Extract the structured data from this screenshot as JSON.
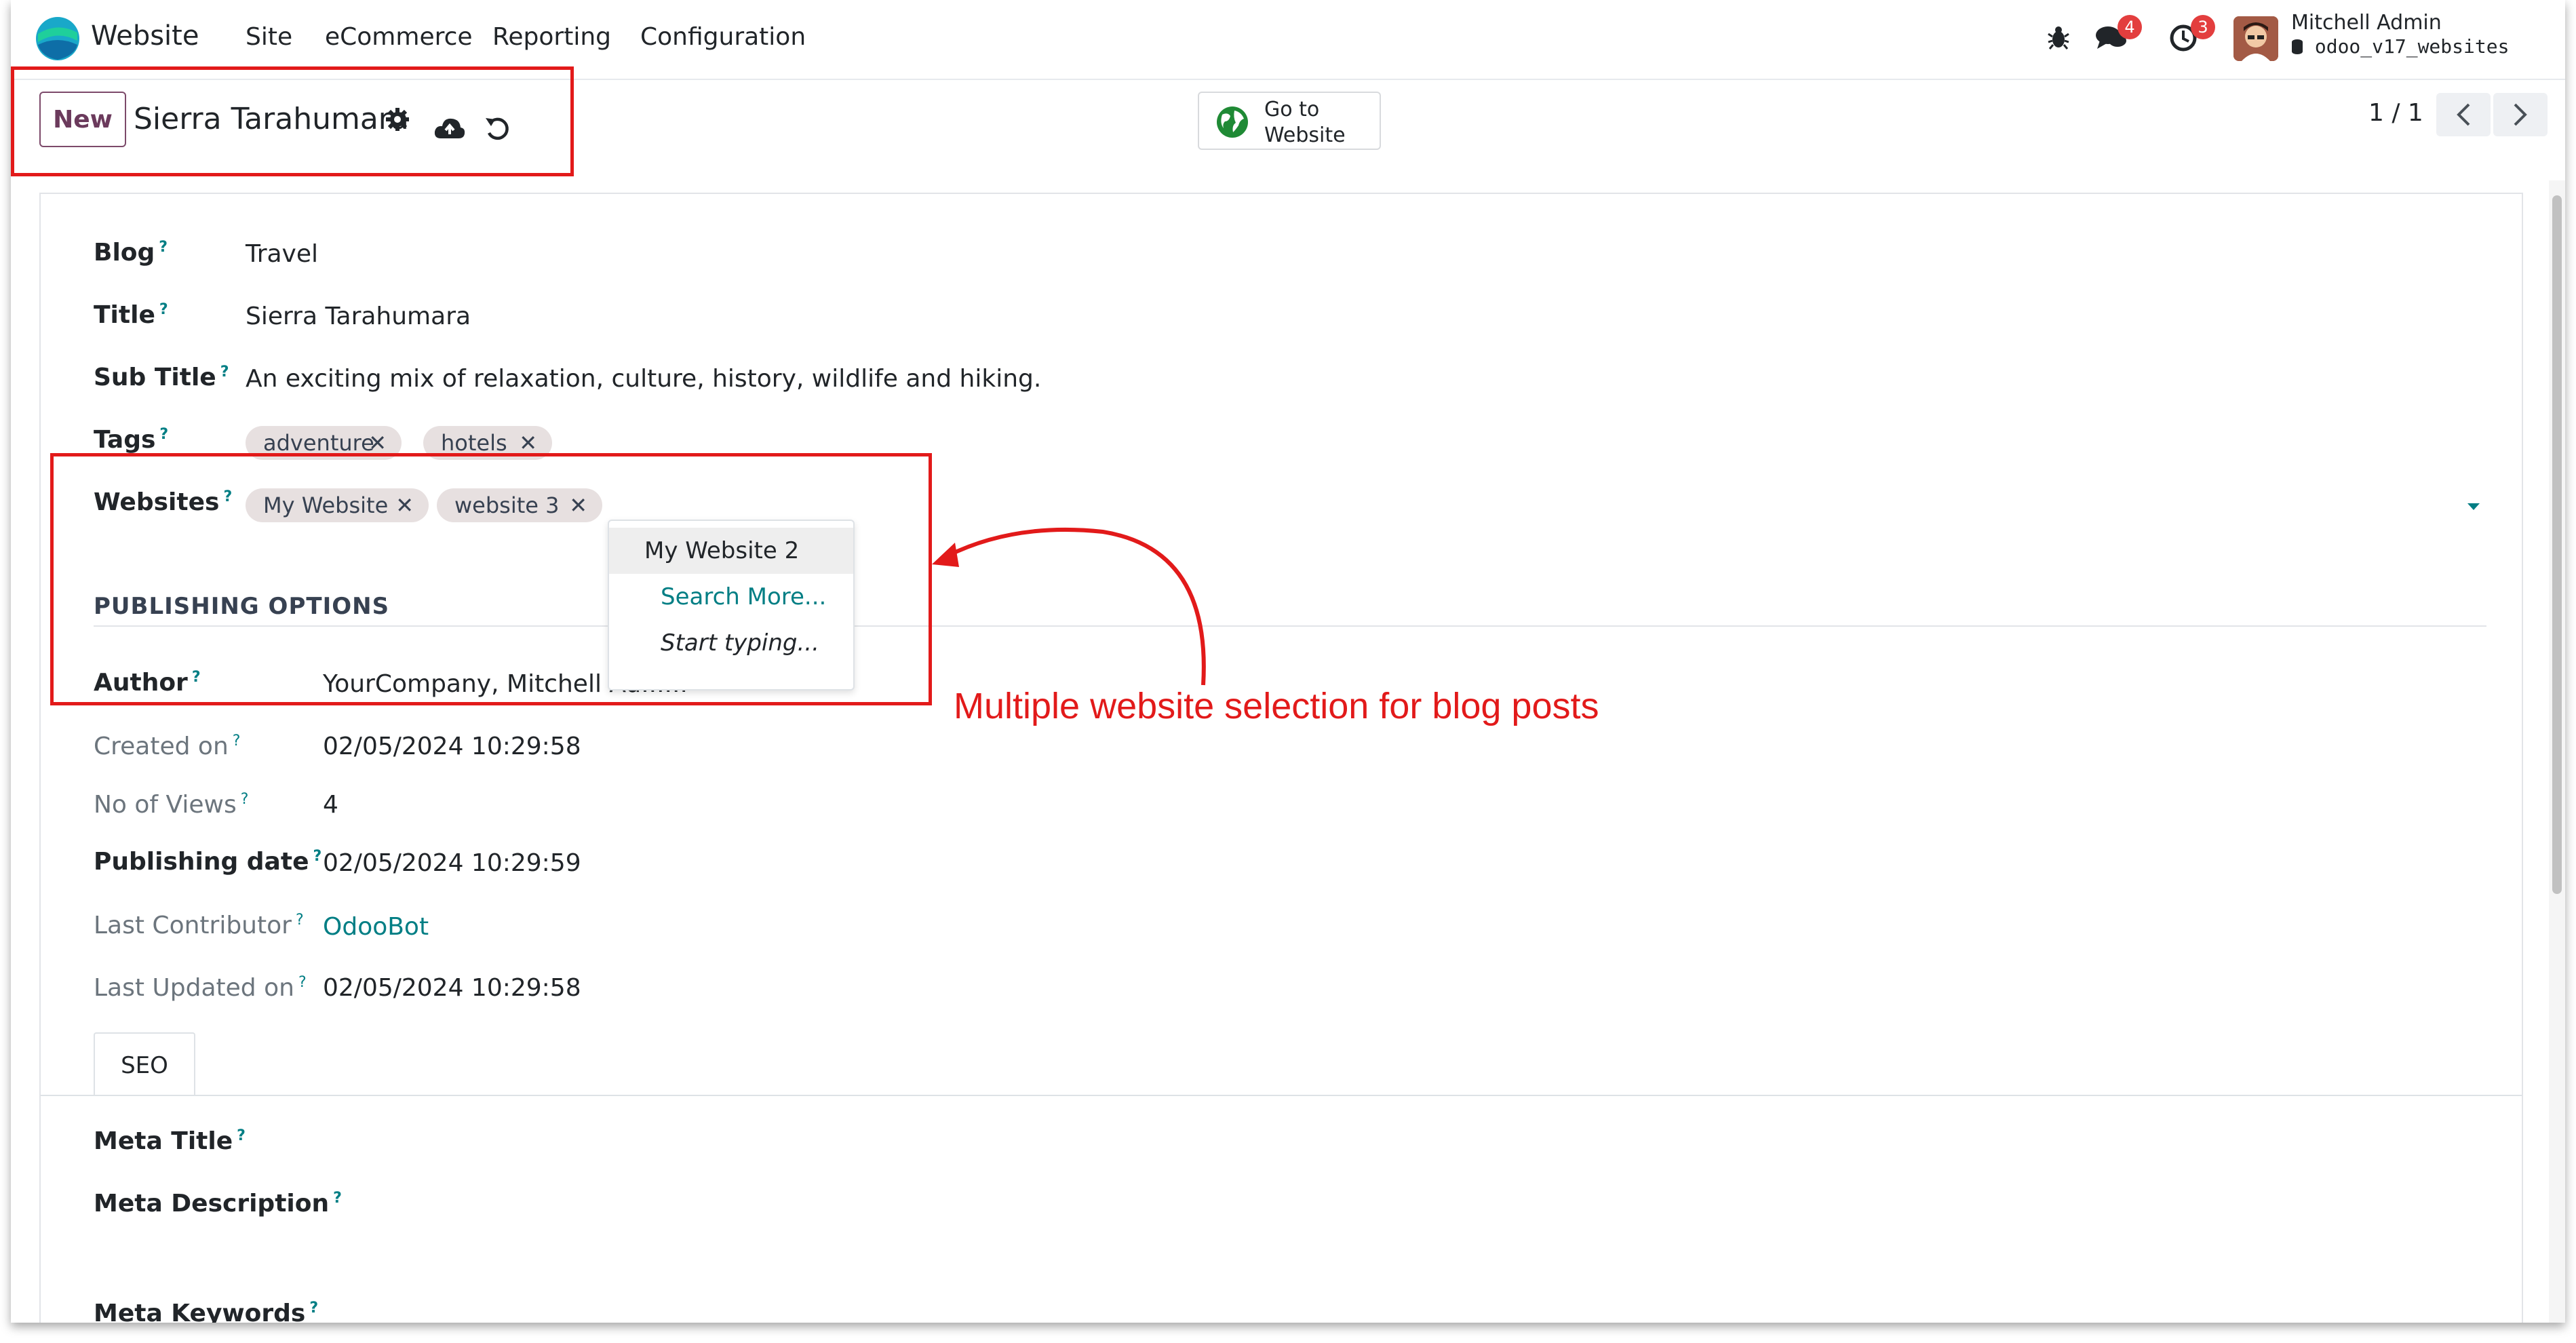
{
  "navbar": {
    "app_name": "Website",
    "menu": [
      "Site",
      "eCommerce",
      "Reporting",
      "Configuration"
    ],
    "messages_badge": "4",
    "activities_badge": "3",
    "user_name": "Mitchell Admin",
    "database": "odoo_v17_websites"
  },
  "control_panel": {
    "new_label": "New",
    "record_title": "Sierra Tarahumara",
    "go_to_website_line1": "Go to",
    "go_to_website_line2": "Website",
    "pager": "1 / 1"
  },
  "form": {
    "blog_label": "Blog",
    "blog_value": "Travel",
    "title_label": "Title",
    "title_value": "Sierra Tarahumara",
    "subtitle_label": "Sub Title",
    "subtitle_value": "An exciting mix of relaxation, culture, history, wildlife and hiking.",
    "tags_label": "Tags",
    "tags": [
      "adventure",
      "hotels"
    ],
    "websites_label": "Websites",
    "websites": [
      "My Website",
      "website 3"
    ],
    "websites_dropdown": [
      "My Website 2",
      "Search More...",
      "Start typing..."
    ],
    "publishing_section": "PUBLISHING OPTIONS",
    "author_label": "Author",
    "author_value": "YourCompany, Mitchell Ad......",
    "created_on_label": "Created on",
    "created_on_value": "02/05/2024 10:29:58",
    "views_label": "No of Views",
    "views_value": "4",
    "publishing_date_label": "Publishing date",
    "publishing_date_value": "02/05/2024 10:29:59",
    "last_contributor_label": "Last Contributor",
    "last_contributor_value": "OdooBot",
    "last_updated_label": "Last Updated on",
    "last_updated_value": "02/05/2024 10:29:58",
    "help_mark": "?"
  },
  "tabs": {
    "seo": "SEO"
  },
  "seo": {
    "meta_title_label": "Meta Title",
    "meta_description_label": "Meta Description",
    "meta_keywords_label": "Meta Keywords"
  },
  "annotation": "Multiple website selection for blog posts",
  "colors": {
    "accent": "#714b67",
    "link": "#017e84",
    "annotation_red": "#e21a1a",
    "badge_red": "#e33e3e"
  },
  "icons": [
    "bug-icon",
    "chat-icon",
    "clock-icon",
    "gear-icon",
    "cloud-upload-icon",
    "undo-icon",
    "globe-icon",
    "chevron-left-icon",
    "chevron-right-icon",
    "caret-down-icon",
    "close-icon"
  ]
}
